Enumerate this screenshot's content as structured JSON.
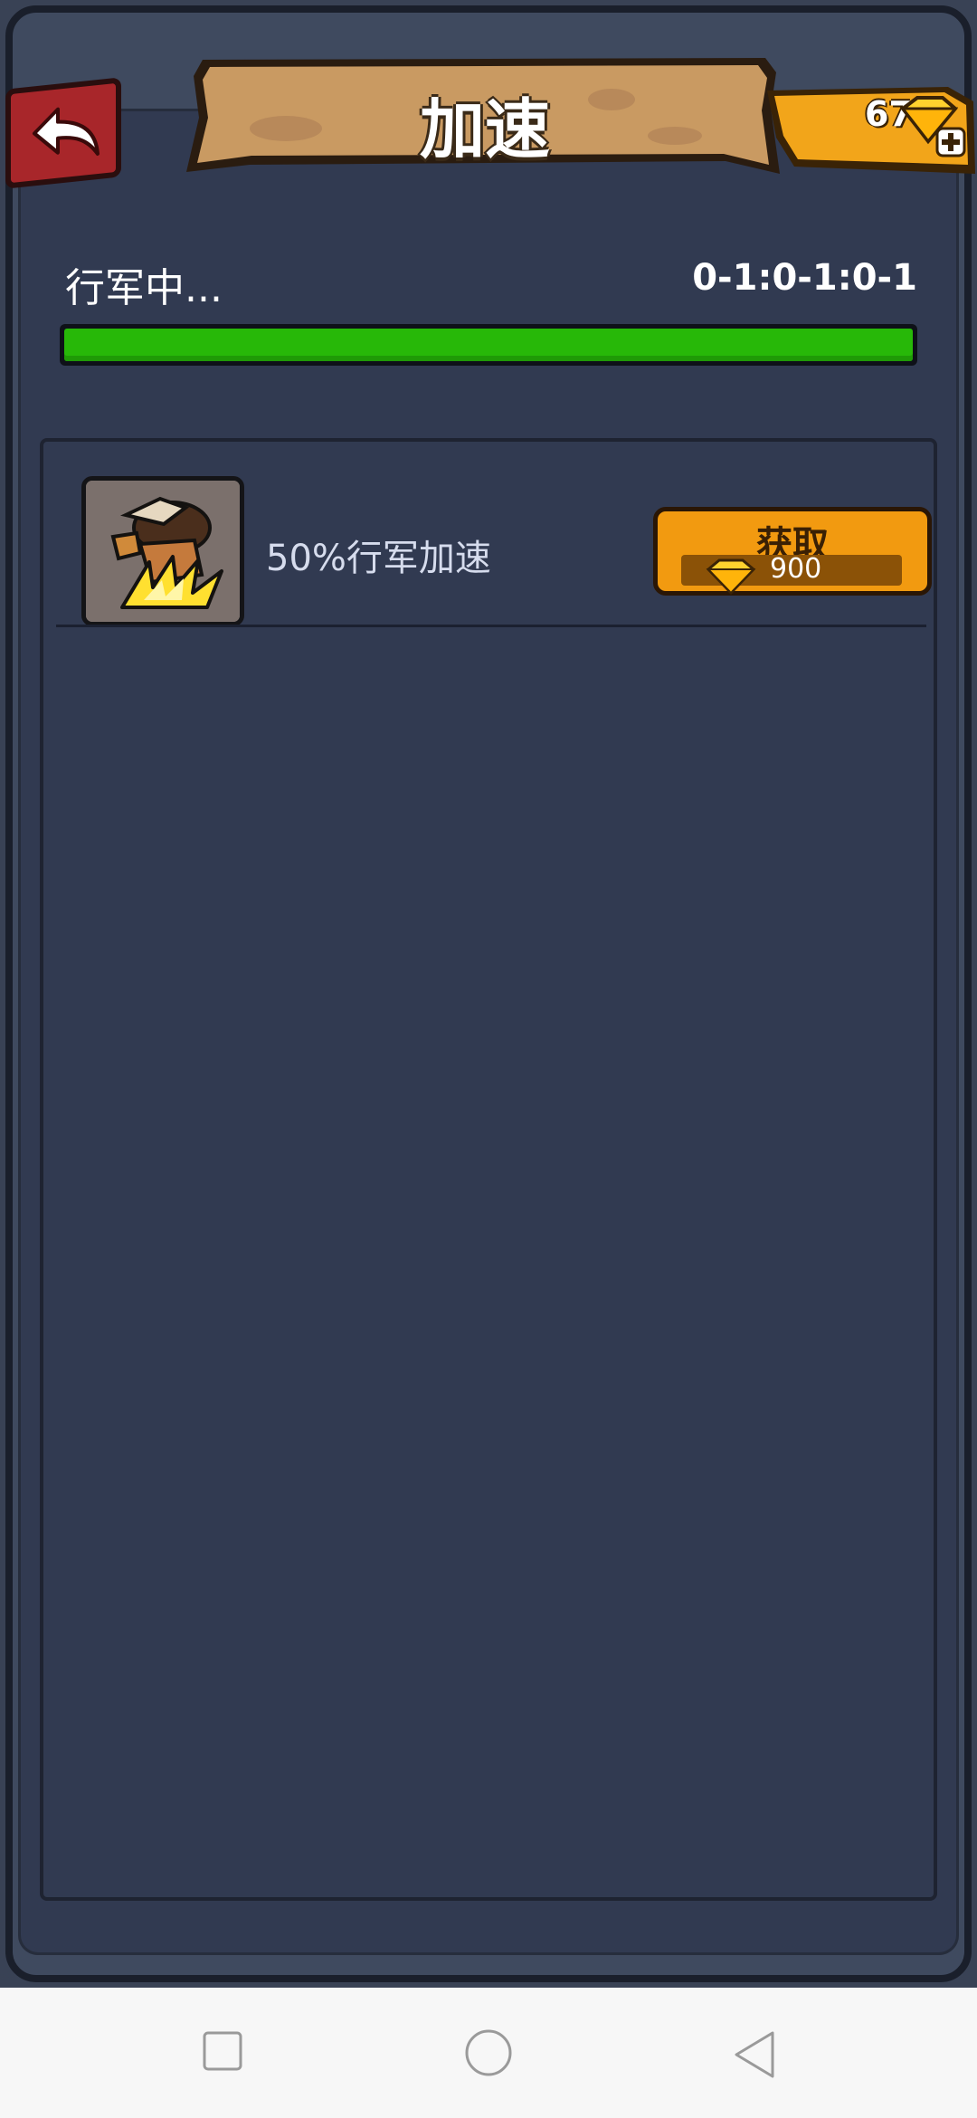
{
  "header": {
    "title": "加速",
    "currency_value": "67"
  },
  "march": {
    "label": "行军中...",
    "time": "0-1:0-1:0-1",
    "progress": 1.0
  },
  "items": [
    {
      "label": "50%行军加速",
      "button_label": "获取",
      "price": "900"
    }
  ],
  "icons": {
    "back": "back-arrow-icon",
    "gem": "gem-icon",
    "plus": "plus-icon",
    "item": "speedup-march-icon"
  },
  "colors": {
    "progress": "#27b808",
    "button": "#f29a10",
    "back": "#a8262a",
    "panel": "#313a51"
  },
  "navbar": {
    "recent": "recent-apps",
    "home": "home",
    "back": "back"
  }
}
